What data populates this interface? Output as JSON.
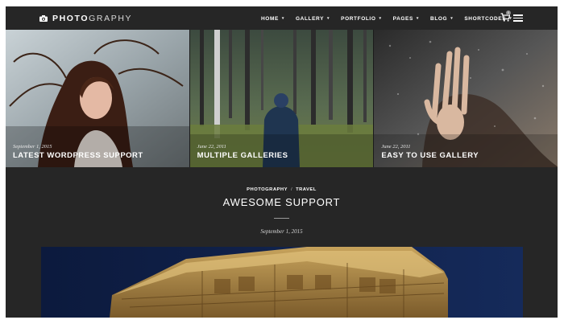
{
  "header": {
    "logo_bold": "PHOTO",
    "logo_light": "GRAPHY",
    "nav": [
      {
        "label": "HOME",
        "caret": "▾"
      },
      {
        "label": "GALLERY",
        "caret": "▾"
      },
      {
        "label": "PORTFOLIO",
        "caret": "▾"
      },
      {
        "label": "PAGES",
        "caret": "▾"
      },
      {
        "label": "BLOG",
        "caret": "▾"
      },
      {
        "label": "SHORTCODES",
        "caret": "▾"
      }
    ],
    "cart_count": "0",
    "icons": {
      "logo": "camera-icon",
      "cart": "cart-icon",
      "menu": "hamburger-menu-icon"
    }
  },
  "slider": [
    {
      "date": "September 1, 2015",
      "title": "LATEST WORDPRESS SUPPORT"
    },
    {
      "date": "June 22, 2011",
      "title": "MULTIPLE GALLERIES"
    },
    {
      "date": "June 22, 2011",
      "title": "EASY TO USE GALLERY"
    }
  ],
  "post": {
    "categories": [
      "PHOTOGRAPHY",
      "TRAVEL"
    ],
    "separator": "/",
    "title": "AWESOME SUPPORT",
    "date": "September 1, 2015"
  },
  "colors": {
    "background": "#262626",
    "text": "#ffffff"
  }
}
